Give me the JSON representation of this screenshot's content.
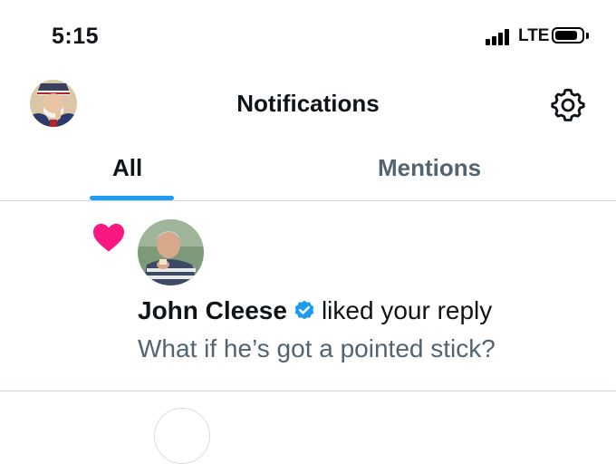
{
  "status_bar": {
    "time": "5:15",
    "network": "LTE",
    "signal_bars": 4,
    "battery_level": 0.85
  },
  "header": {
    "title": "Notifications",
    "avatar_icon": "profile-avatar",
    "settings_icon": "gear-icon"
  },
  "tabs": [
    {
      "label": "All",
      "selected": true
    },
    {
      "label": "Mentions",
      "selected": false
    }
  ],
  "notification": {
    "type_icon": "heart-icon",
    "user_name": "John Cleese",
    "verified": true,
    "action": "liked your reply",
    "tweet_text": "What if he’s got a pointed stick?"
  },
  "colors": {
    "accent": "#1d9bf0",
    "heart": "#f91880",
    "secondary_text": "#536471",
    "divider": "#cfd9de"
  }
}
